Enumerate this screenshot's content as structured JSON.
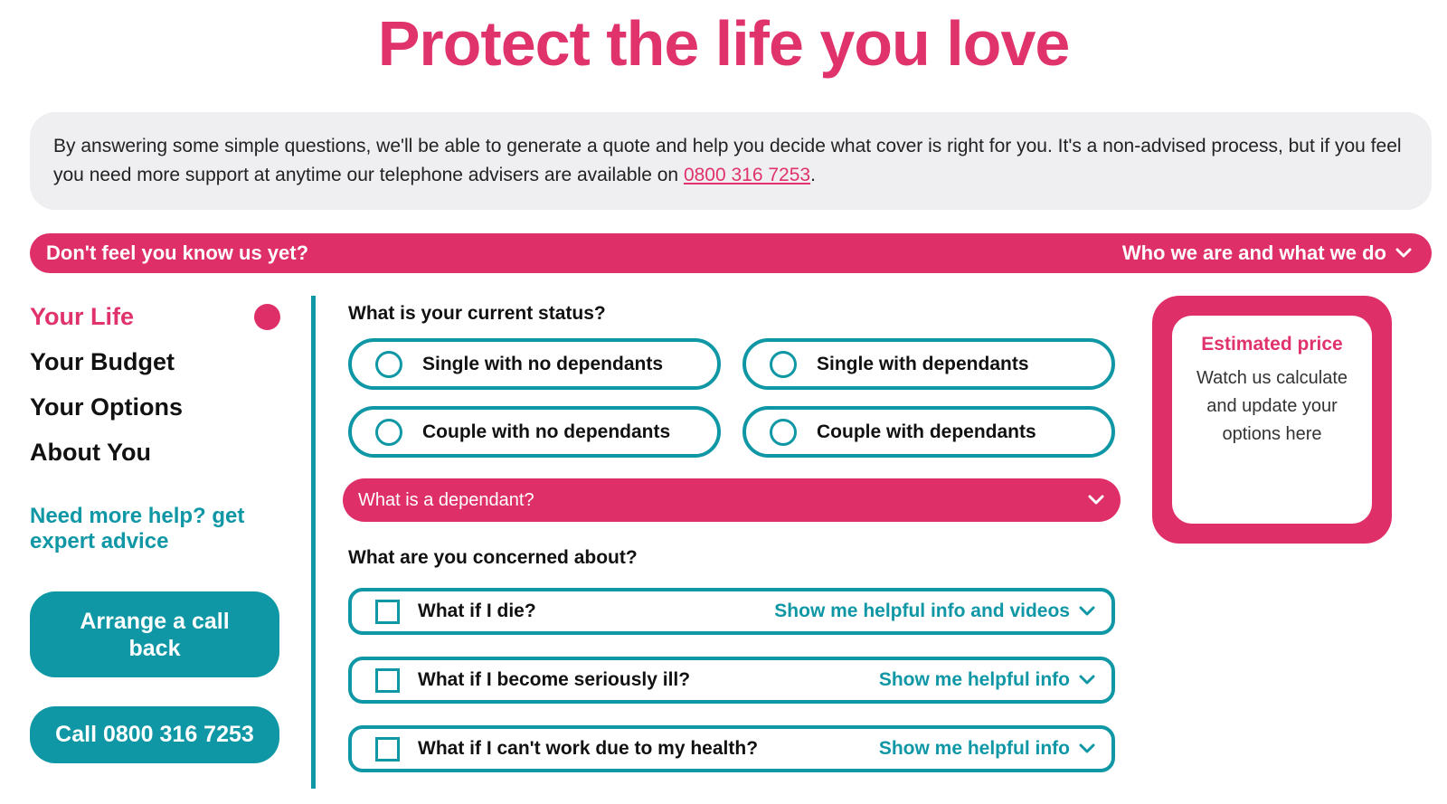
{
  "title": "Protect the life you love",
  "intro": {
    "text": "By answering some simple questions, we'll be able to generate a quote and help you decide what cover is right for you. It's a non-advised process, but if you feel you need more support at anytime our telephone advisers are available on ",
    "phone": "0800 316 7253",
    "end": "."
  },
  "know_bar": {
    "left": "Don't feel you know us yet?",
    "right": "Who we are and what we do"
  },
  "sidebar": {
    "steps": [
      "Your Life",
      "Your Budget",
      "Your Options",
      "About You"
    ],
    "help_link": "Need more help? get expert advice",
    "callback_button": "Arrange a call back",
    "call_button": "Call 0800 316 7253"
  },
  "status": {
    "question": "What is your current status?",
    "options": [
      "Single with no dependants",
      "Single with dependants",
      "Couple with no dependants",
      "Couple with dependants"
    ]
  },
  "dependant_bar": "What is a dependant?",
  "concerns": {
    "question": "What are you concerned about?",
    "items": [
      {
        "label": "What if I die?",
        "info": "Show me helpful info and videos"
      },
      {
        "label": "What if I become seriously ill?",
        "info": "Show me helpful info"
      },
      {
        "label": "What if I can't work due to my health?",
        "info": "Show me helpful info"
      }
    ]
  },
  "price_box": {
    "title": "Estimated price",
    "text": "Watch us calculate and update your options here"
  },
  "colors": {
    "accent": "#df2f69",
    "teal": "#0f97a6"
  }
}
